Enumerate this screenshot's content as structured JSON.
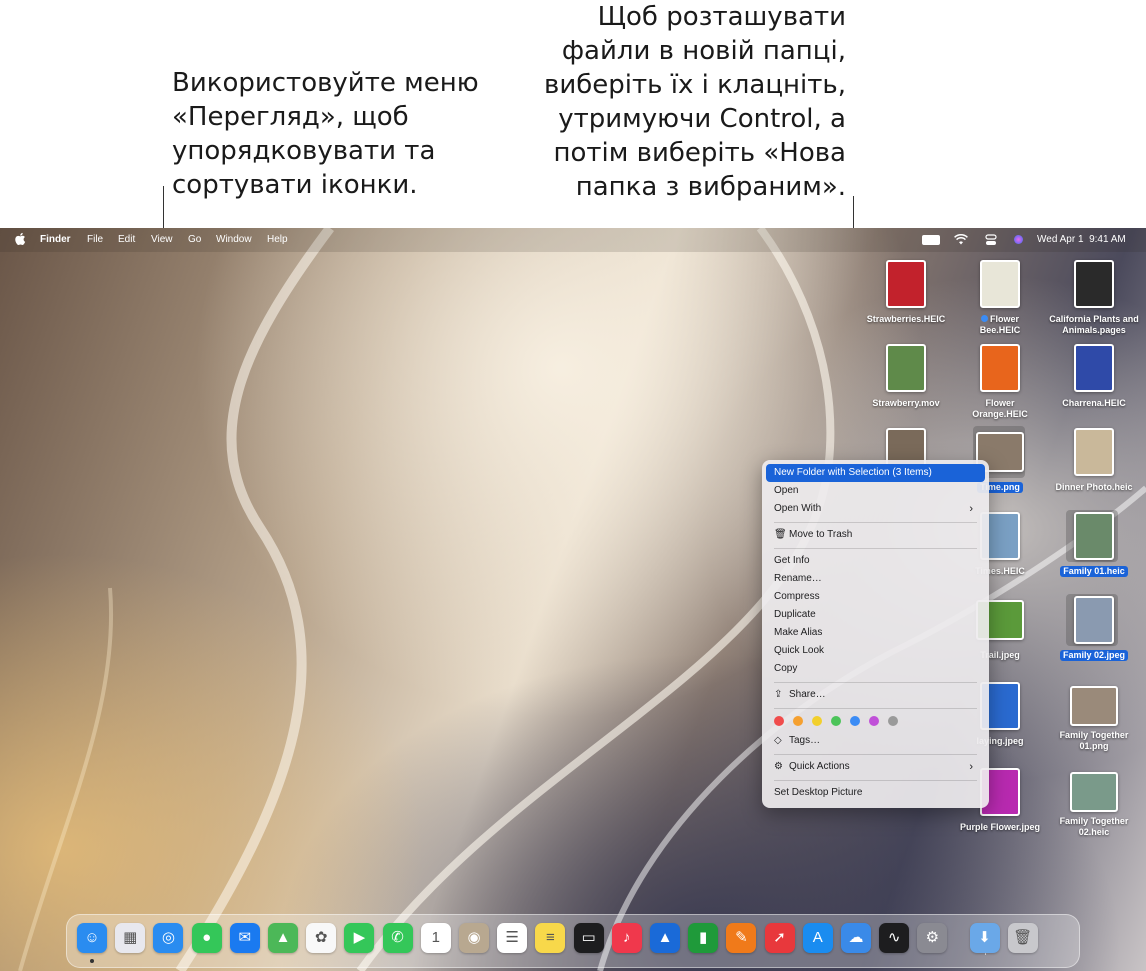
{
  "callouts": {
    "left": "Використовуйте меню «Перегляд», щоб упорядковувати та сортувати іконки.",
    "right": "Щоб розташувати файли в новій папці, виберіть їх і клацніть, утримуючи Control, а потім виберіть «Нова папка з вибраним»."
  },
  "menubar": {
    "app": "Finder",
    "items": [
      "File",
      "Edit",
      "View",
      "Go",
      "Window",
      "Help"
    ],
    "datetime": "Wed Apr 1  9:41 AM"
  },
  "desktop": {
    "files": [
      {
        "label": "Strawberries.HEIC",
        "color": "#c2222c"
      },
      {
        "label": "Flower Bee.HEIC",
        "color": "#e8e6d8",
        "tagged": true
      },
      {
        "label": "California Plants and Animals.pages",
        "color": "#2a2a2a"
      },
      {
        "label": "Strawberry.mov",
        "color": "#5f8a4a"
      },
      {
        "label": "Flower Orange.HEIC",
        "color": "#e8651c"
      },
      {
        "label": "Charrena.HEIC",
        "color": "#2f4aa8"
      },
      {
        "label": "Time.png",
        "color": "#8a7a6a",
        "selected": true
      },
      {
        "label": "Dinner Photo.heic",
        "color": "#c9b89a"
      },
      {
        "label": "Times.HEIC",
        "color": "#7aa0c4"
      },
      {
        "label": "Family 01.heic",
        "color": "#6a8a6a",
        "selected": true
      },
      {
        "label": "Trail.jpeg",
        "color": "#5b9a3a"
      },
      {
        "label": "Family 02.jpeg",
        "color": "#8a9ab0",
        "selected": true
      },
      {
        "label": "laying.jpeg",
        "color": "#2a6ad0"
      },
      {
        "label": "Family Together 01.png",
        "color": "#9a8a7a"
      },
      {
        "label": "Purple Flower.jpeg",
        "color": "#b82ab0"
      },
      {
        "label": "Family Together 02.heic",
        "color": "#7a9a8a"
      }
    ]
  },
  "context_menu": {
    "new_folder": "New Folder with Selection (3 Items)",
    "open": "Open",
    "open_with": "Open With",
    "move_to_trash": "Move to Trash",
    "get_info": "Get Info",
    "rename": "Rename…",
    "compress": "Compress",
    "duplicate": "Duplicate",
    "make_alias": "Make Alias",
    "quick_look": "Quick Look",
    "copy": "Copy",
    "share": "Share…",
    "tag_colors": [
      "#f04c4c",
      "#f5a030",
      "#f2cf2c",
      "#4cc45a",
      "#3b8cf5",
      "#c050d8",
      "#9a9a9a"
    ],
    "tags": "Tags…",
    "quick_actions": "Quick Actions",
    "set_desktop_picture": "Set Desktop Picture"
  },
  "dock": {
    "apps": [
      {
        "name": "finder-icon",
        "color": "#2a8cf0",
        "glyph": "☺"
      },
      {
        "name": "launchpad-icon",
        "color": "#e8e8ee",
        "glyph": "▦"
      },
      {
        "name": "safari-icon",
        "color": "#2a8cf0",
        "glyph": "◎"
      },
      {
        "name": "messages-icon",
        "color": "#34c759",
        "glyph": "●"
      },
      {
        "name": "mail-icon",
        "color": "#1a7af0",
        "glyph": "✉"
      },
      {
        "name": "maps-icon",
        "color": "#4cb858",
        "glyph": "▲"
      },
      {
        "name": "photos-icon",
        "color": "#f8f8f8",
        "glyph": "✿"
      },
      {
        "name": "facetime-icon",
        "color": "#34c759",
        "glyph": "▶"
      },
      {
        "name": "phone-icon",
        "color": "#34c759",
        "glyph": "✆"
      },
      {
        "name": "calendar-icon",
        "color": "#ffffff",
        "glyph": "1"
      },
      {
        "name": "contacts-icon",
        "color": "#b8a890",
        "glyph": "◉"
      },
      {
        "name": "reminders-icon",
        "color": "#ffffff",
        "glyph": "☰"
      },
      {
        "name": "notes-icon",
        "color": "#f8d84a",
        "glyph": "≡"
      },
      {
        "name": "tv-icon",
        "color": "#1d1d1f",
        "glyph": "▭"
      },
      {
        "name": "music-icon",
        "color": "#f0384c",
        "glyph": "♪"
      },
      {
        "name": "keynote-icon",
        "color": "#1a6ad8",
        "glyph": "▲"
      },
      {
        "name": "numbers-icon",
        "color": "#1f9a3a",
        "glyph": "▮"
      },
      {
        "name": "pages-icon",
        "color": "#f07a1a",
        "glyph": "✎"
      },
      {
        "name": "toolbox-icon",
        "color": "#e8383c",
        "glyph": "➚"
      },
      {
        "name": "app-store-icon",
        "color": "#1a8cf0",
        "glyph": "A"
      },
      {
        "name": "weather-icon",
        "color": "#3a8ae8",
        "glyph": "☁"
      },
      {
        "name": "stocks-icon",
        "color": "#1d1d1f",
        "glyph": "∿"
      },
      {
        "name": "system-settings-icon",
        "color": "#8a8a92",
        "glyph": "⚙"
      },
      {
        "name": "downloads-folder-icon",
        "color": "#6aa8e8",
        "glyph": "⬇"
      },
      {
        "name": "trash-icon",
        "color": "#c8c8cc",
        "glyph": "🗑"
      }
    ]
  }
}
